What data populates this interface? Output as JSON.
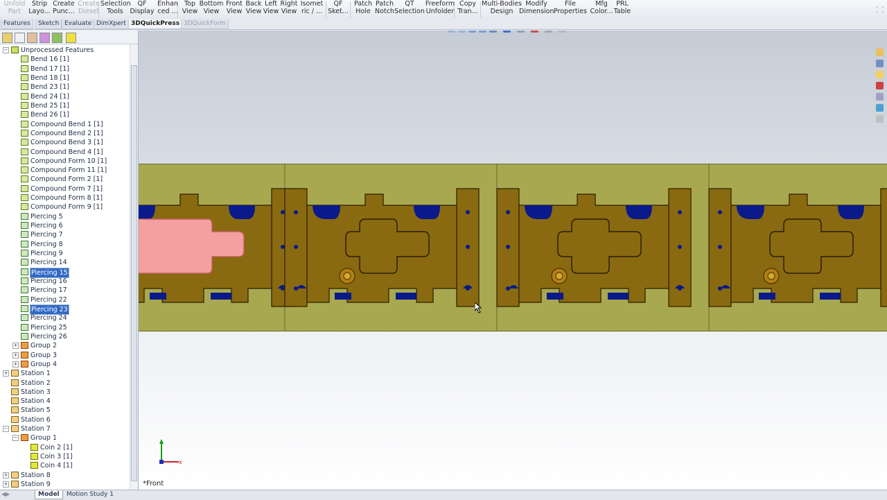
{
  "ribbon": {
    "buttons": [
      {
        "label": "Unfold\nPart",
        "disabled": true
      },
      {
        "label": "Strip\nLayo...",
        "disabled": false
      },
      {
        "label": "Create\nPunc...",
        "disabled": false
      },
      {
        "label": "Create\nDieset",
        "disabled": true
      },
      {
        "label": "Selection\nTools",
        "disabled": false
      },
      {
        "label": "QF\nDisplay",
        "disabled": false
      },
      {
        "label": "Enhan\nced ...",
        "disabled": false
      },
      {
        "label": "Top\nView",
        "disabled": false
      },
      {
        "label": "Bottom\nView",
        "disabled": false
      },
      {
        "label": "Front\nView",
        "disabled": false
      },
      {
        "label": "Back\nView",
        "disabled": false
      },
      {
        "label": "Left\nView",
        "disabled": false
      },
      {
        "label": "Right\nView",
        "disabled": false
      },
      {
        "label": "Isomet\nric / ...",
        "disabled": false
      },
      {
        "label": "QF\nSket...",
        "disabled": false
      },
      {
        "label": "Patch\nHole",
        "disabled": false
      },
      {
        "label": "Patch\nNotch",
        "disabled": false
      },
      {
        "label": "QT\nSelection",
        "disabled": false
      },
      {
        "label": "Freeform\nUnfolder",
        "disabled": false
      },
      {
        "label": "Copy\nTran...",
        "disabled": false
      },
      {
        "label": "Multi-Bodies\nDesign",
        "disabled": false
      },
      {
        "label": "Modify\nDimension",
        "disabled": false
      },
      {
        "label": "File\nProperties",
        "disabled": false
      },
      {
        "label": "Mfg\nColor...",
        "disabled": false
      },
      {
        "label": "PRL\nTable",
        "disabled": false
      }
    ]
  },
  "tabs": [
    {
      "label": "Features"
    },
    {
      "label": "Sketch"
    },
    {
      "label": "Evaluate"
    },
    {
      "label": "DimXpert"
    },
    {
      "label": "3DQuickPress"
    },
    {
      "label": "3DQuickForm"
    }
  ],
  "tree": {
    "items": [
      {
        "label": "Unprocessed Features",
        "icon": "feature-folder-icon",
        "level": 0,
        "expander": "-"
      },
      {
        "label": "Bend 16 [1]",
        "icon": "feature-icon",
        "level": 1
      },
      {
        "label": "Bend 17 [1]",
        "icon": "feature-icon",
        "level": 1
      },
      {
        "label": "Bend 18 [1]",
        "icon": "feature-icon",
        "level": 1
      },
      {
        "label": "Bend 23 [1]",
        "icon": "feature-icon",
        "level": 1
      },
      {
        "label": "Bend 24 [1]",
        "icon": "feature-icon",
        "level": 1
      },
      {
        "label": "Bend 25 [1]",
        "icon": "feature-icon",
        "level": 1
      },
      {
        "label": "Bend 26 [1]",
        "icon": "feature-icon",
        "level": 1
      },
      {
        "label": "Compound Bend 1 [1]",
        "icon": "feature-icon",
        "level": 1
      },
      {
        "label": "Compound Bend 2 [1]",
        "icon": "feature-icon",
        "level": 1
      },
      {
        "label": "Compound Bend 3 [1]",
        "icon": "feature-icon",
        "level": 1
      },
      {
        "label": "Compound Bend 4 [1]",
        "icon": "feature-icon",
        "level": 1
      },
      {
        "label": "Compound Form 10 [1]",
        "icon": "feature-icon",
        "level": 1
      },
      {
        "label": "Compound Form 11 [1]",
        "icon": "feature-icon",
        "level": 1
      },
      {
        "label": "Compound Form 2 [1]",
        "icon": "feature-icon",
        "level": 1
      },
      {
        "label": "Compound Form 7 [1]",
        "icon": "feature-icon",
        "level": 1
      },
      {
        "label": "Compound Form 8 [1]",
        "icon": "feature-icon",
        "level": 1
      },
      {
        "label": "Compound Form 9 [1]",
        "icon": "feature-icon",
        "level": 1
      },
      {
        "label": "Piercing 5",
        "icon": "piercing-icon",
        "level": 1
      },
      {
        "label": "Piercing 6",
        "icon": "piercing-icon",
        "level": 1
      },
      {
        "label": "Piercing 7",
        "icon": "piercing-icon",
        "level": 1
      },
      {
        "label": "Piercing 8",
        "icon": "piercing-icon",
        "level": 1
      },
      {
        "label": "Piercing 9",
        "icon": "piercing-icon",
        "level": 1
      },
      {
        "label": "Piercing 14",
        "icon": "piercing-icon",
        "level": 1
      },
      {
        "label": "Piercing 15",
        "icon": "piercing-icon",
        "level": 1,
        "selected": true
      },
      {
        "label": "Piercing 16",
        "icon": "piercing-icon",
        "level": 1
      },
      {
        "label": "Piercing 17",
        "icon": "piercing-icon",
        "level": 1
      },
      {
        "label": "Piercing 22",
        "icon": "piercing-icon",
        "level": 1
      },
      {
        "label": "Piercing 23",
        "icon": "piercing-icon",
        "level": 1,
        "selected": true
      },
      {
        "label": "Piercing 24",
        "icon": "piercing-icon",
        "level": 1
      },
      {
        "label": "Piercing 25",
        "icon": "piercing-icon",
        "level": 1
      },
      {
        "label": "Piercing 26",
        "icon": "piercing-icon",
        "level": 1
      },
      {
        "label": "Group 2",
        "icon": "group-icon",
        "level": 1,
        "expander": "+"
      },
      {
        "label": "Group 3",
        "icon": "group-icon",
        "level": 1,
        "expander": "+"
      },
      {
        "label": "Group 4",
        "icon": "group-icon",
        "level": 1,
        "expander": "+"
      },
      {
        "label": "Station 1",
        "icon": "station-icon",
        "level": 0,
        "expander": "+"
      },
      {
        "label": "Station 2",
        "icon": "station-icon",
        "level": 0
      },
      {
        "label": "Station 3",
        "icon": "station-icon",
        "level": 0
      },
      {
        "label": "Station 4",
        "icon": "station-icon",
        "level": 0
      },
      {
        "label": "Station 5",
        "icon": "station-icon",
        "level": 0
      },
      {
        "label": "Station 6",
        "icon": "station-icon",
        "level": 0
      },
      {
        "label": "Station 7",
        "icon": "station-icon",
        "level": 0,
        "expander": "-"
      },
      {
        "label": "Group 1",
        "icon": "group-icon",
        "level": 1,
        "expander": "-"
      },
      {
        "label": "Coin 2 [1]",
        "icon": "coin-icon",
        "level": 2
      },
      {
        "label": "Coin 3 [1]",
        "icon": "coin-icon",
        "level": 2
      },
      {
        "label": "Coin 4 [1]",
        "icon": "coin-icon",
        "level": 2
      },
      {
        "label": "Station 8",
        "icon": "station-icon",
        "level": 0,
        "expander": "+"
      },
      {
        "label": "Station 9",
        "icon": "station-icon",
        "level": 0,
        "expander": "+"
      }
    ]
  },
  "viewport": {
    "view_name": "*Front",
    "triad_x_label": "x",
    "colors": {
      "strip_background": "#a8a850",
      "part_fill": "#8a6a10",
      "part_outline": "#2a1e00",
      "pierce_highlight": "#f4a0a0",
      "slot_fill": "#0a1a8a"
    }
  },
  "bottom_tabs": [
    {
      "label": "Model"
    },
    {
      "label": "Motion Study 1"
    }
  ]
}
